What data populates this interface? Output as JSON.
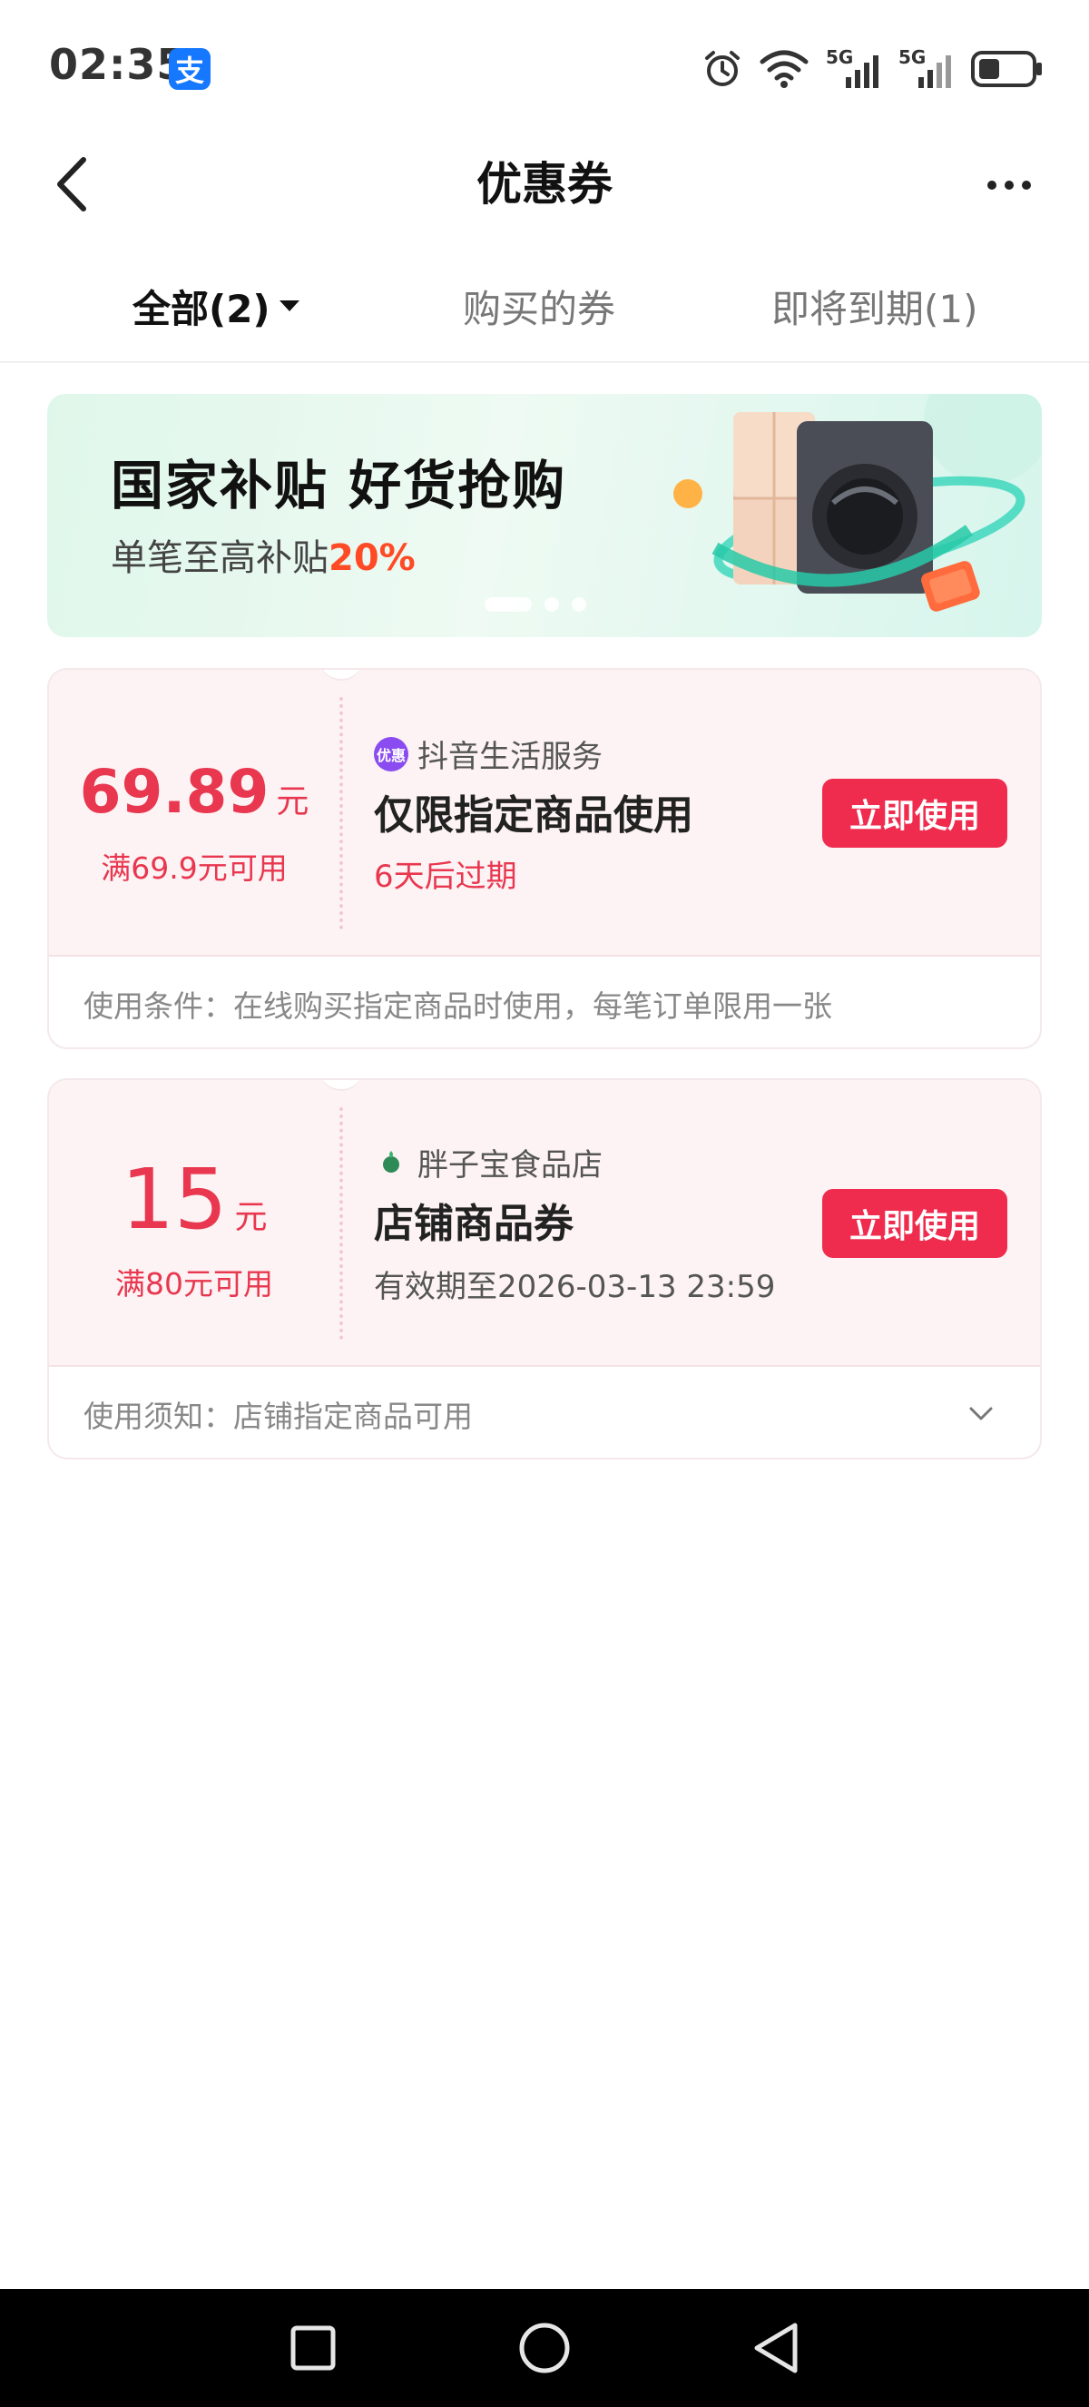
{
  "status_bar": {
    "time": "02:35",
    "app_badge": "支",
    "network_1": "5G",
    "network_2": "5G"
  },
  "nav": {
    "title": "优惠券"
  },
  "tabs": [
    {
      "label": "全部(2)",
      "active": true
    },
    {
      "label": "购买的券",
      "active": false
    },
    {
      "label": "即将到期(1)",
      "active": false
    }
  ],
  "banner": {
    "title": "国家补贴 好货抢购",
    "subtitle_prefix": "单笔至高补贴",
    "subtitle_highlight": "20%",
    "dot_count": 3,
    "active_dot": 0
  },
  "coupons": [
    {
      "amount": "69.89",
      "unit": "元",
      "threshold": "满69.9元可用",
      "merchant_logo_text": "优惠",
      "merchant": "抖音生活服务",
      "name": "仅限指定商品使用",
      "expiry": "6天后过期",
      "expiry_color": "#e8374f",
      "button": "立即使用",
      "condition": "使用条件：在线购买指定商品时使用，每笔订单限用一张"
    },
    {
      "amount": "15",
      "unit": "元",
      "threshold": "满80元可用",
      "merchant": "胖子宝食品店",
      "name": "店铺商品券",
      "expiry": "有效期至2026-03-13 23:59",
      "expiry_color": "#555555",
      "button": "立即使用",
      "condition": "使用须知：店铺指定商品可用"
    }
  ],
  "colors": {
    "accent_red": "#ef2c4e",
    "price_red": "#e8374f",
    "banner_bg": "#dff7ea",
    "alipay_blue": "#1677ff"
  }
}
